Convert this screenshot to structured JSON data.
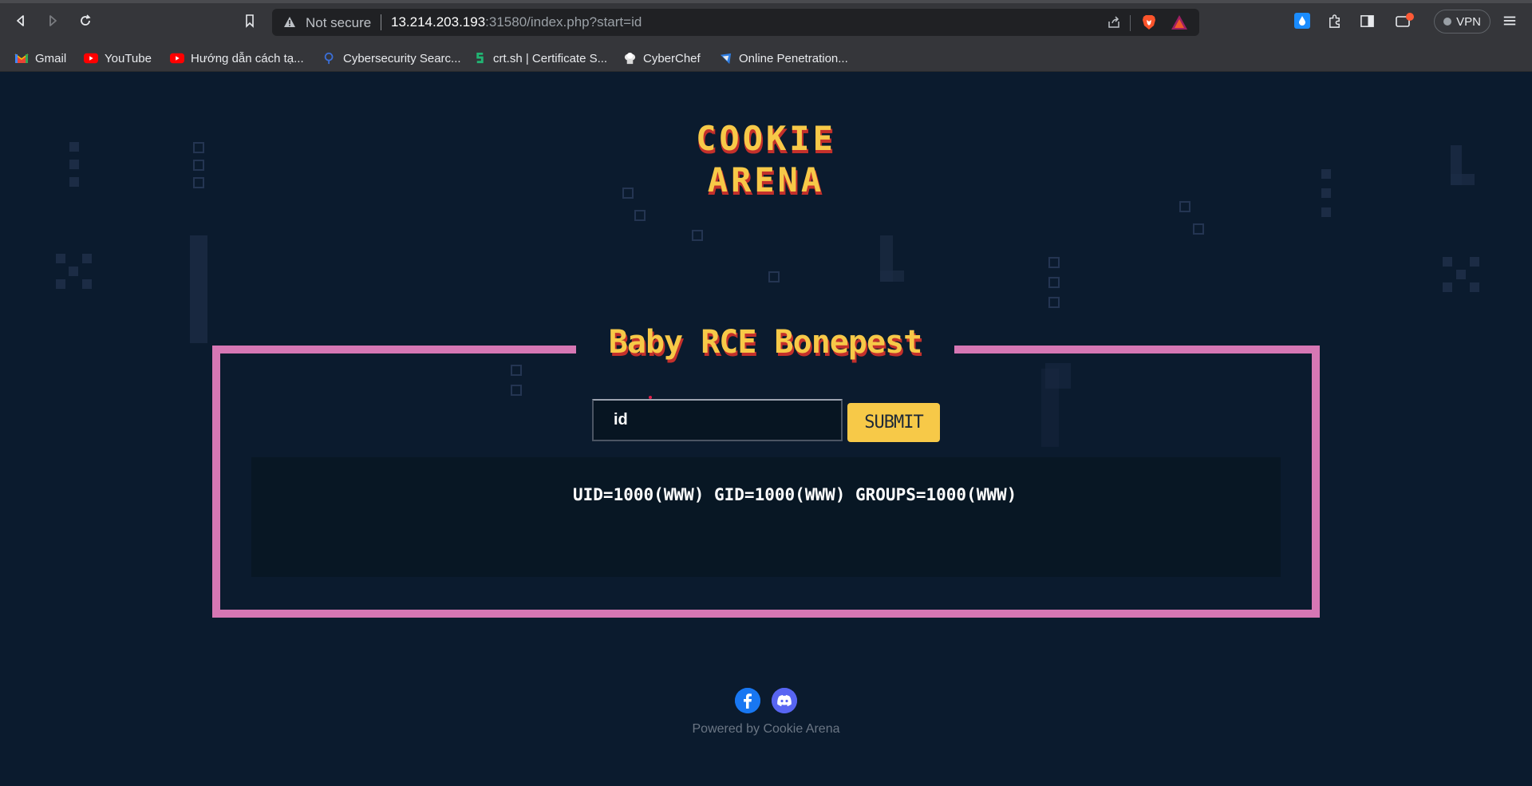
{
  "browser": {
    "address": {
      "security_label": "Not secure",
      "url_host": "13.214.203.193",
      "url_rest": ":31580/index.php?start=id"
    },
    "vpn_label": "VPN",
    "bookmarks": [
      {
        "label": "Gmail",
        "icon": "gmail-icon"
      },
      {
        "label": "YouTube",
        "icon": "youtube-icon"
      },
      {
        "label": "Hướng dẫn cách tạ...",
        "icon": "youtube-icon"
      },
      {
        "label": "Cybersecurity Searc...",
        "icon": "search-engine-icon"
      },
      {
        "label": "crt.sh | Certificate S...",
        "icon": "crtsh-icon"
      },
      {
        "label": "CyberChef",
        "icon": "chef-hat-icon"
      },
      {
        "label": "Online Penetration...",
        "icon": "pentest-icon"
      }
    ]
  },
  "page": {
    "logo_line1": "COOKIE",
    "logo_line2": "ARENA",
    "challenge_title": "Baby RCE Bonepest",
    "command_input_value": "id",
    "submit_label": "SUBMIT",
    "output_text": "UID=1000(WWW) GID=1000(WWW) GROUPS=1000(WWW)",
    "footer": "Powered by Cookie Arena",
    "social": [
      "facebook-icon",
      "discord-icon"
    ]
  },
  "colors": {
    "background": "#0b1b2e",
    "frame": "#d677b4",
    "accent_yellow": "#f7c948",
    "accent_red": "#c4302b"
  }
}
